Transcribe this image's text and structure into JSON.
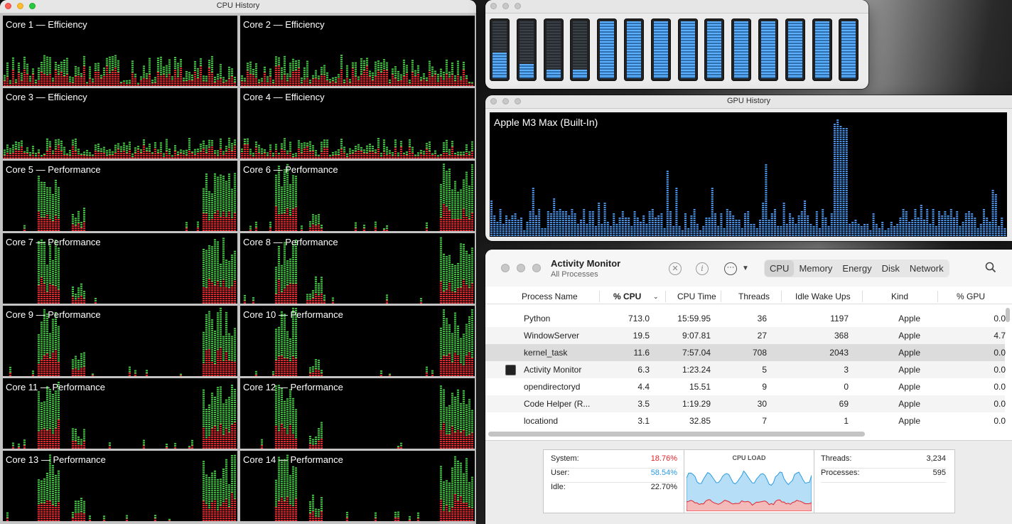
{
  "cpu_history": {
    "title": "CPU History",
    "cores": [
      {
        "label": "Core 1 — Efficiency"
      },
      {
        "label": "Core 2 — Efficiency"
      },
      {
        "label": "Core 3 — Efficiency"
      },
      {
        "label": "Core 4 — Efficiency"
      },
      {
        "label": "Core 5 — Performance"
      },
      {
        "label": "Core 6 — Performance"
      },
      {
        "label": "Core 7 — Performance"
      },
      {
        "label": "Core 8 — Performance"
      },
      {
        "label": "Core 9 — Performance"
      },
      {
        "label": "Core 10 — Performance"
      },
      {
        "label": "Core 11 — Performance"
      },
      {
        "label": "Core 12 — Performance"
      },
      {
        "label": "Core 13 — Performance"
      },
      {
        "label": "Core 14 — Performance"
      }
    ],
    "colors": {
      "system": "#e0242a",
      "user": "#3ec43e",
      "background": "#000000"
    }
  },
  "cpu_meter": {
    "core_loads": [
      0.45,
      0.25,
      0.15,
      0.15,
      1,
      1,
      1,
      1,
      1,
      1,
      1,
      1,
      1,
      1
    ]
  },
  "gpu_history": {
    "title": "GPU History",
    "gpu_name": "Apple M3 Max (Built-In)",
    "color": "#4a90e2"
  },
  "activity_monitor": {
    "title": "Activity Monitor",
    "subtitle": "All Processes",
    "tabs": [
      "CPU",
      "Memory",
      "Energy",
      "Disk",
      "Network"
    ],
    "active_tab": "CPU",
    "columns": [
      "Process Name",
      "% CPU",
      "CPU Time",
      "Threads",
      "Idle Wake Ups",
      "Kind",
      "% GPU"
    ],
    "rows": [
      {
        "name": "Python",
        "cpu": "713.0",
        "time": "15:59.95",
        "threads": "36",
        "wakeups": "1197",
        "kind": "Apple",
        "gpu": "0.0"
      },
      {
        "name": "WindowServer",
        "cpu": "19.5",
        "time": "9:07.81",
        "threads": "27",
        "wakeups": "368",
        "kind": "Apple",
        "gpu": "4.7"
      },
      {
        "name": "kernel_task",
        "cpu": "11.6",
        "time": "7:57.04",
        "threads": "708",
        "wakeups": "2043",
        "kind": "Apple",
        "gpu": "0.0"
      },
      {
        "name": "Activity Monitor",
        "cpu": "6.3",
        "time": "1:23.24",
        "threads": "5",
        "wakeups": "3",
        "kind": "Apple",
        "gpu": "0.0"
      },
      {
        "name": "opendirectoryd",
        "cpu": "4.4",
        "time": "15.51",
        "threads": "9",
        "wakeups": "0",
        "kind": "Apple",
        "gpu": "0.0"
      },
      {
        "name": "Code Helper (R...",
        "cpu": "3.5",
        "time": "1:19.29",
        "threads": "30",
        "wakeups": "69",
        "kind": "Apple",
        "gpu": "0.0"
      },
      {
        "name": "locationd",
        "cpu": "3.1",
        "time": "32.85",
        "threads": "7",
        "wakeups": "1",
        "kind": "Apple",
        "gpu": "0.0"
      }
    ],
    "stats": {
      "system_label": "System:",
      "system_value": "18.76%",
      "system_color": "#e0242a",
      "user_label": "User:",
      "user_value": "58.54%",
      "user_color": "#2a9be0",
      "idle_label": "Idle:",
      "idle_value": "22.70%",
      "cpu_load_title": "CPU LOAD",
      "threads_label": "Threads:",
      "threads_value": "3,234",
      "processes_label": "Processes:",
      "processes_value": "595"
    }
  }
}
